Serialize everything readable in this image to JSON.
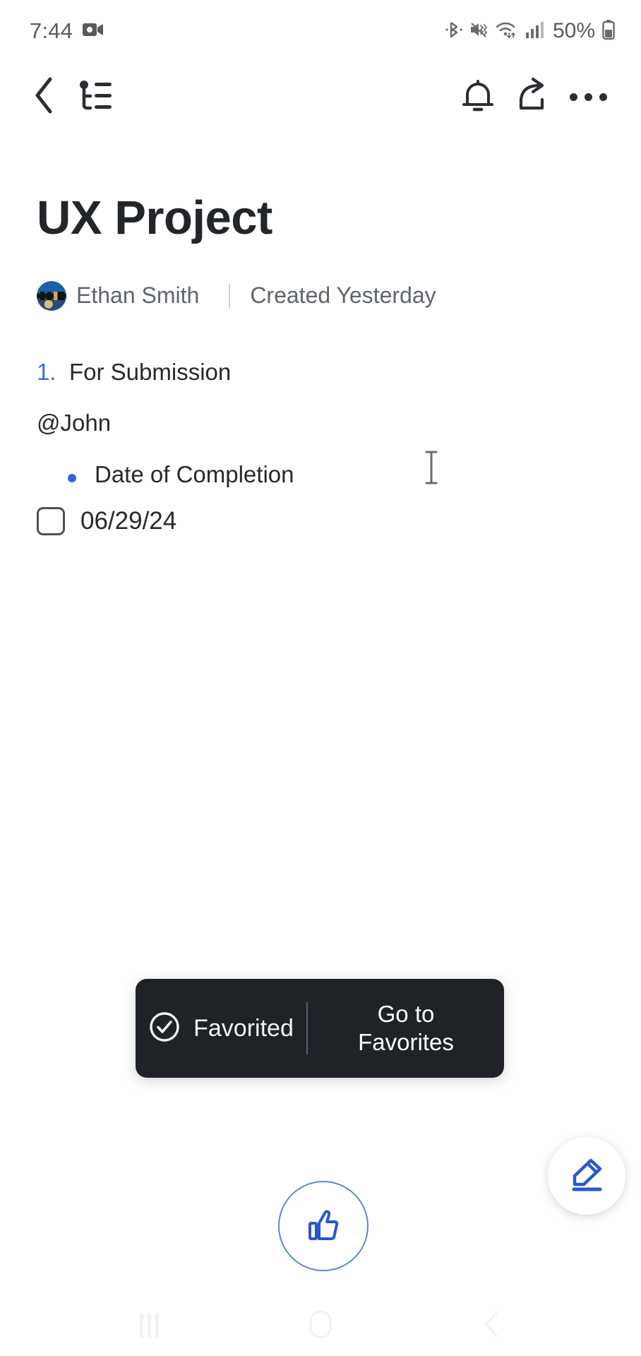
{
  "status_bar": {
    "time": "7:44",
    "battery_percent": "50%",
    "icons": [
      "screen-record-icon",
      "bluetooth-icon",
      "mute-vibrate-icon",
      "wifi-icon",
      "cellular-signal-icon",
      "battery-icon"
    ]
  },
  "toolbar": {
    "back_label": "Back",
    "outline_label": "Outline",
    "notifications_label": "Notifications",
    "share_label": "Share",
    "more_label": "More options"
  },
  "document": {
    "title": "UX Project",
    "author": "Ethan Smith",
    "created": "Created Yesterday",
    "items": [
      {
        "marker": "1.",
        "text": "For Submission"
      },
      {
        "marker": "",
        "text": "@John"
      },
      {
        "marker": "bullet",
        "text": "Date of Completion"
      },
      {
        "marker": "checkbox",
        "text": "06/29/24",
        "checked": false
      }
    ]
  },
  "toast": {
    "message": "Favorited",
    "action": "Go to\nFavorites",
    "action_line1": "Go to",
    "action_line2": "Favorites",
    "icon": "check-circle-icon"
  },
  "floating_buttons": {
    "like_label": "Like",
    "edit_label": "Edit"
  },
  "nav_bar": {
    "recents_label": "Recents",
    "home_label": "Home",
    "back_label": "Back"
  },
  "colors": {
    "accent_blue": "#2f68d8",
    "fab_blue": "#2a57d0",
    "toast_bg": "#1f2328",
    "text_dark": "#26292d",
    "text_muted": "#5f656b"
  }
}
